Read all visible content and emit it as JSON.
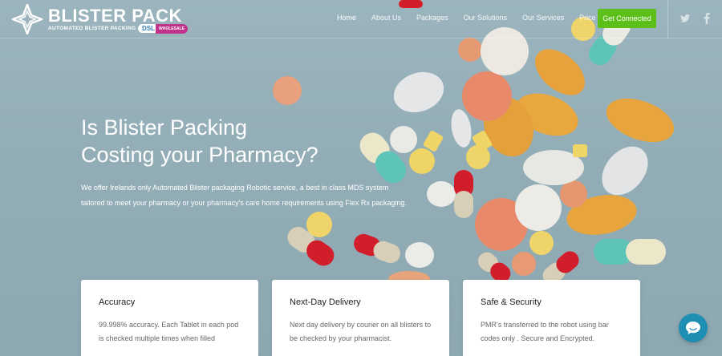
{
  "brand": {
    "title": "BLISTER PACK",
    "subtitle": "AUTOMATED BLISTER PACKING",
    "badge_dsl": "DSL",
    "badge_wholesale": "WHOLESALE"
  },
  "nav": {
    "items": [
      {
        "label": "Home",
        "active": true
      },
      {
        "label": "About Us"
      },
      {
        "label": "Packages"
      },
      {
        "label": "Our Solutions"
      },
      {
        "label": "Our Services"
      },
      {
        "label": "Price list"
      }
    ],
    "cta": "Get Connected",
    "social": [
      "twitter-icon",
      "facebook-icon"
    ]
  },
  "hero": {
    "title_line1": "Is Blister Packing",
    "title_line2": "Costing your Pharmacy?",
    "description": "We offer Irelands only Automated Blister packaging Robotic service, a best in class MDS system tailored to meet your pharmacy or your pharmacy's care home requirements using Flex Rx packaging."
  },
  "features": [
    {
      "title": "Accuracy",
      "text": "99.998% accuracy. Each Tablet in each pod is checked multiple times when filled"
    },
    {
      "title": "Next-Day Delivery",
      "text": "Next day delivery by courier on all blisters to be checked by your pharmacist."
    },
    {
      "title": "Safe & Security",
      "text": "PMR's transferred to the robot using bar codes only . Secure and Encrypted."
    }
  ],
  "colors": {
    "cta": "#5cbf1a",
    "chat": "#1d8fb3",
    "hero_bg": "#93adb7"
  }
}
